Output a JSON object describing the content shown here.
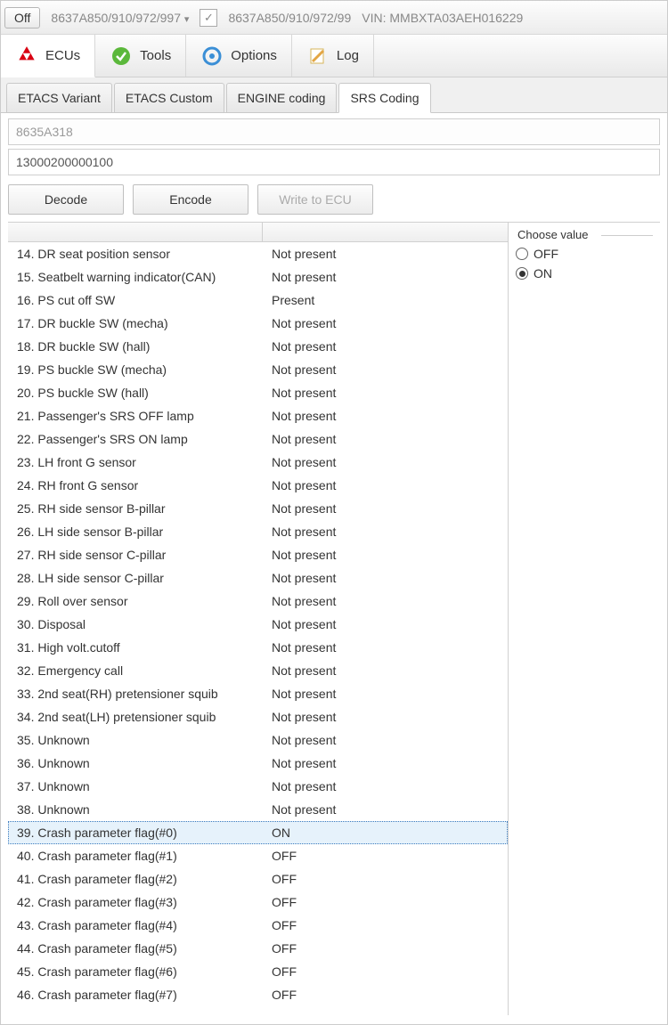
{
  "topbar": {
    "off_label": "Off",
    "crumb1": "8637A850/910/972/997",
    "checkbox_checked": "✓",
    "crumb2": "8637A850/910/972/99",
    "vin_label": "VIN: MMBXTA03AEH016229"
  },
  "mainnav": {
    "ecus": "ECUs",
    "tools": "Tools",
    "options": "Options",
    "log": "Log"
  },
  "subnav": {
    "etacs_variant": "ETACS Variant",
    "etacs_custom": "ETACS Custom",
    "engine_coding": "ENGINE coding",
    "srs_coding": "SRS Coding"
  },
  "inputs": {
    "partno": "8635A318",
    "code": "13000200000100"
  },
  "buttons": {
    "decode": "Decode",
    "encode": "Encode",
    "write": "Write to ECU"
  },
  "table": {
    "rows": [
      {
        "n": "14",
        "name": "DR seat position sensor",
        "val": "Not present",
        "sel": false
      },
      {
        "n": "15",
        "name": "Seatbelt warning indicator(CAN)",
        "val": "Not present",
        "sel": false
      },
      {
        "n": "16",
        "name": "PS cut off SW",
        "val": "Present",
        "sel": false
      },
      {
        "n": "17",
        "name": "DR buckle SW (mecha)",
        "val": "Not present",
        "sel": false
      },
      {
        "n": "18",
        "name": "DR buckle SW (hall)",
        "val": "Not present",
        "sel": false
      },
      {
        "n": "19",
        "name": "PS buckle SW (mecha)",
        "val": "Not present",
        "sel": false
      },
      {
        "n": "20",
        "name": "PS buckle SW (hall)",
        "val": "Not present",
        "sel": false
      },
      {
        "n": "21",
        "name": "Passenger's SRS OFF lamp",
        "val": "Not present",
        "sel": false
      },
      {
        "n": "22",
        "name": "Passenger's SRS ON lamp",
        "val": "Not present",
        "sel": false
      },
      {
        "n": "23",
        "name": "LH front G sensor",
        "val": "Not present",
        "sel": false
      },
      {
        "n": "24",
        "name": "RH front G sensor",
        "val": "Not present",
        "sel": false
      },
      {
        "n": "25",
        "name": "RH side sensor B-pillar",
        "val": "Not present",
        "sel": false
      },
      {
        "n": "26",
        "name": "LH side sensor B-pillar",
        "val": "Not present",
        "sel": false
      },
      {
        "n": "27",
        "name": "RH side sensor C-pillar",
        "val": "Not present",
        "sel": false
      },
      {
        "n": "28",
        "name": "LH side sensor C-pillar",
        "val": "Not present",
        "sel": false
      },
      {
        "n": "29",
        "name": "Roll over sensor",
        "val": "Not present",
        "sel": false
      },
      {
        "n": "30",
        "name": "Disposal",
        "val": "Not present",
        "sel": false
      },
      {
        "n": "31",
        "name": "High volt.cutoff",
        "val": "Not present",
        "sel": false
      },
      {
        "n": "32",
        "name": "Emergency call",
        "val": "Not present",
        "sel": false
      },
      {
        "n": "33",
        "name": "2nd seat(RH) pretensioner squib",
        "val": "Not present",
        "sel": false
      },
      {
        "n": "34",
        "name": "2nd seat(LH) pretensioner squib",
        "val": "Not present",
        "sel": false
      },
      {
        "n": "35",
        "name": "Unknown",
        "val": "Not present",
        "sel": false
      },
      {
        "n": "36",
        "name": "Unknown",
        "val": "Not present",
        "sel": false
      },
      {
        "n": "37",
        "name": "Unknown",
        "val": "Not present",
        "sel": false
      },
      {
        "n": "38",
        "name": "Unknown",
        "val": "Not present",
        "sel": false
      },
      {
        "n": "39",
        "name": "Crash parameter flag(#0)",
        "val": "ON",
        "sel": true
      },
      {
        "n": "40",
        "name": "Crash parameter flag(#1)",
        "val": "OFF",
        "sel": false
      },
      {
        "n": "41",
        "name": "Crash parameter flag(#2)",
        "val": "OFF",
        "sel": false
      },
      {
        "n": "42",
        "name": "Crash parameter flag(#3)",
        "val": "OFF",
        "sel": false
      },
      {
        "n": "43",
        "name": "Crash parameter flag(#4)",
        "val": "OFF",
        "sel": false
      },
      {
        "n": "44",
        "name": "Crash parameter flag(#5)",
        "val": "OFF",
        "sel": false
      },
      {
        "n": "45",
        "name": "Crash parameter flag(#6)",
        "val": "OFF",
        "sel": false
      },
      {
        "n": "46",
        "name": "Crash parameter flag(#7)",
        "val": "OFF",
        "sel": false
      }
    ]
  },
  "side": {
    "legend": "Choose value",
    "off": "OFF",
    "on": "ON",
    "selected": "ON"
  }
}
